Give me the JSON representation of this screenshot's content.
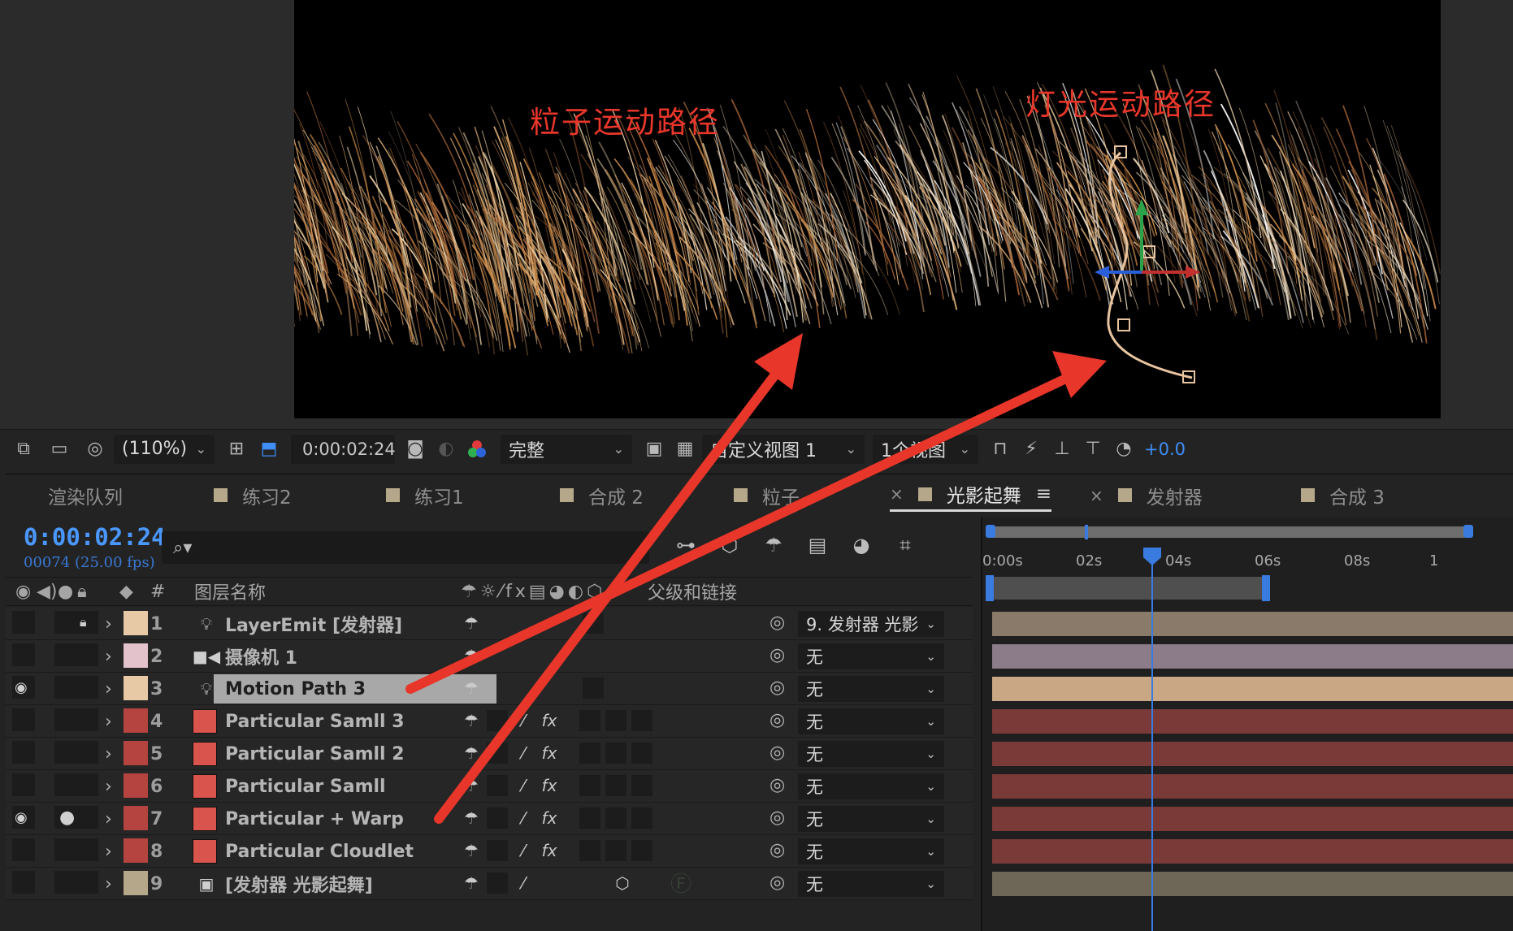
{
  "viewer": {
    "annotation_particle": "粒子运动路径",
    "annotation_light": "灯光运动路径"
  },
  "viewer_toolbar": {
    "zoom": "(110%)",
    "time": "0:00:02:24",
    "resolution": "完整",
    "view": "自定义视图 1",
    "view_count": "1个视图",
    "exposure": "+0.0"
  },
  "tabs": [
    {
      "label": "渲染队列",
      "color": null
    },
    {
      "label": "练习2",
      "color": "#b5a88a"
    },
    {
      "label": "练习1",
      "color": "#b5a88a"
    },
    {
      "label": "合成 2",
      "color": "#b5a88a"
    },
    {
      "label": "粒子",
      "color": "#b5a88a"
    },
    {
      "label": "光影起舞",
      "color": "#b5a88a",
      "active": true
    },
    {
      "label": "发射器",
      "color": "#b5a88a"
    },
    {
      "label": "合成 3",
      "color": "#b5a88a"
    }
  ],
  "timeline": {
    "current_time": "0:00:02:24",
    "frame_info": "00074 (25.00 fps)",
    "search_icon": "search-icon",
    "col_number": "#",
    "col_layer_name": "图层名称",
    "col_parent": "父级和链接",
    "ruler_ticks": [
      "0:00s",
      "02s",
      "04s",
      "06s",
      "08s",
      "1"
    ]
  },
  "layers": [
    {
      "num": "1",
      "name": "LayerEmit [发射器]",
      "type": "light",
      "label_color": "#e8c9a6",
      "parent": "9. 发射器 光影",
      "locked": true,
      "visible": false,
      "bar_color": "#8a7a6a"
    },
    {
      "num": "2",
      "name": "摄像机 1",
      "type": "camera",
      "label_color": "#e3c2cc",
      "parent": "无",
      "locked": false,
      "visible": false,
      "bar_color": "#8c7b88"
    },
    {
      "num": "3",
      "name": "Motion Path 3",
      "type": "light",
      "label_color": "#e8c9a6",
      "parent": "无",
      "locked": false,
      "visible": true,
      "selected": true,
      "bar_color": "#c9a684"
    },
    {
      "num": "4",
      "name": "Particular Samll 3",
      "type": "solid",
      "label_color": "#b5433f",
      "parent": "无",
      "fx": true,
      "bar_color": "#7a3a38"
    },
    {
      "num": "5",
      "name": "Particular Samll 2",
      "type": "solid",
      "label_color": "#b5433f",
      "parent": "无",
      "fx": true,
      "bar_color": "#7a3a38"
    },
    {
      "num": "6",
      "name": "Particular Samll",
      "type": "solid",
      "label_color": "#b5433f",
      "parent": "无",
      "fx": true,
      "bar_color": "#7a3a38"
    },
    {
      "num": "7",
      "name": "Particular + Warp",
      "type": "solid",
      "label_color": "#b5433f",
      "parent": "无",
      "fx": true,
      "visible": true,
      "solo": true,
      "bar_color": "#7a3a38"
    },
    {
      "num": "8",
      "name": "Particular Cloudlet",
      "type": "solid",
      "label_color": "#b5433f",
      "parent": "无",
      "fx": true,
      "bar_color": "#7a3a38"
    },
    {
      "num": "9",
      "name": "[发射器 光影起舞]",
      "type": "comp",
      "label_color": "#b5a88a",
      "parent": "无",
      "bar_color": "#6e6656"
    }
  ],
  "colors": {
    "accent_blue": "#3f8ef5",
    "annotation_red": "#e8362a"
  }
}
